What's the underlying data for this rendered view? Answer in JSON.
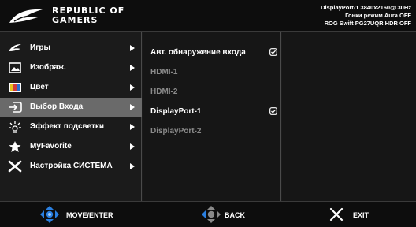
{
  "header": {
    "brand_line1": "REPUBLIC OF",
    "brand_line2": "GAMERS",
    "status_line1": "DisplayPort-1  3840x2160@ 30Hz",
    "status_line2": "Гонки режим   Aura OFF",
    "status_line3": "ROG Swift PG27UQR HDR OFF"
  },
  "menu": {
    "items": [
      {
        "label": "Игры",
        "icon": "rog-claw-icon"
      },
      {
        "label": "Изображ.",
        "icon": "image-icon"
      },
      {
        "label": "Цвет",
        "icon": "color-palette-icon"
      },
      {
        "label": "Выбор Входа",
        "icon": "input-icon"
      },
      {
        "label": "Эффект подсветки",
        "icon": "light-effect-icon"
      },
      {
        "label": "MyFavorite",
        "icon": "star-icon"
      },
      {
        "label": "Настройка СИСТЕМА",
        "icon": "tools-icon"
      }
    ],
    "selected_index": 3
  },
  "submenu": {
    "options": [
      {
        "label": "Авт. обнаружение входа",
        "enabled": true,
        "checked": true
      },
      {
        "label": "HDMI-1",
        "enabled": false,
        "checked": false
      },
      {
        "label": "HDMI-2",
        "enabled": false,
        "checked": false
      },
      {
        "label": "DisplayPort-1",
        "enabled": true,
        "checked": true
      },
      {
        "label": "DisplayPort-2",
        "enabled": false,
        "checked": false
      }
    ]
  },
  "footer": {
    "move_enter": "MOVE/ENTER",
    "back": "BACK",
    "exit": "EXIT"
  },
  "colors": {
    "accent_blue": "#2a7fe0",
    "selected_bg": "#6a6a6a",
    "disabled_text": "#8a8a8a"
  }
}
